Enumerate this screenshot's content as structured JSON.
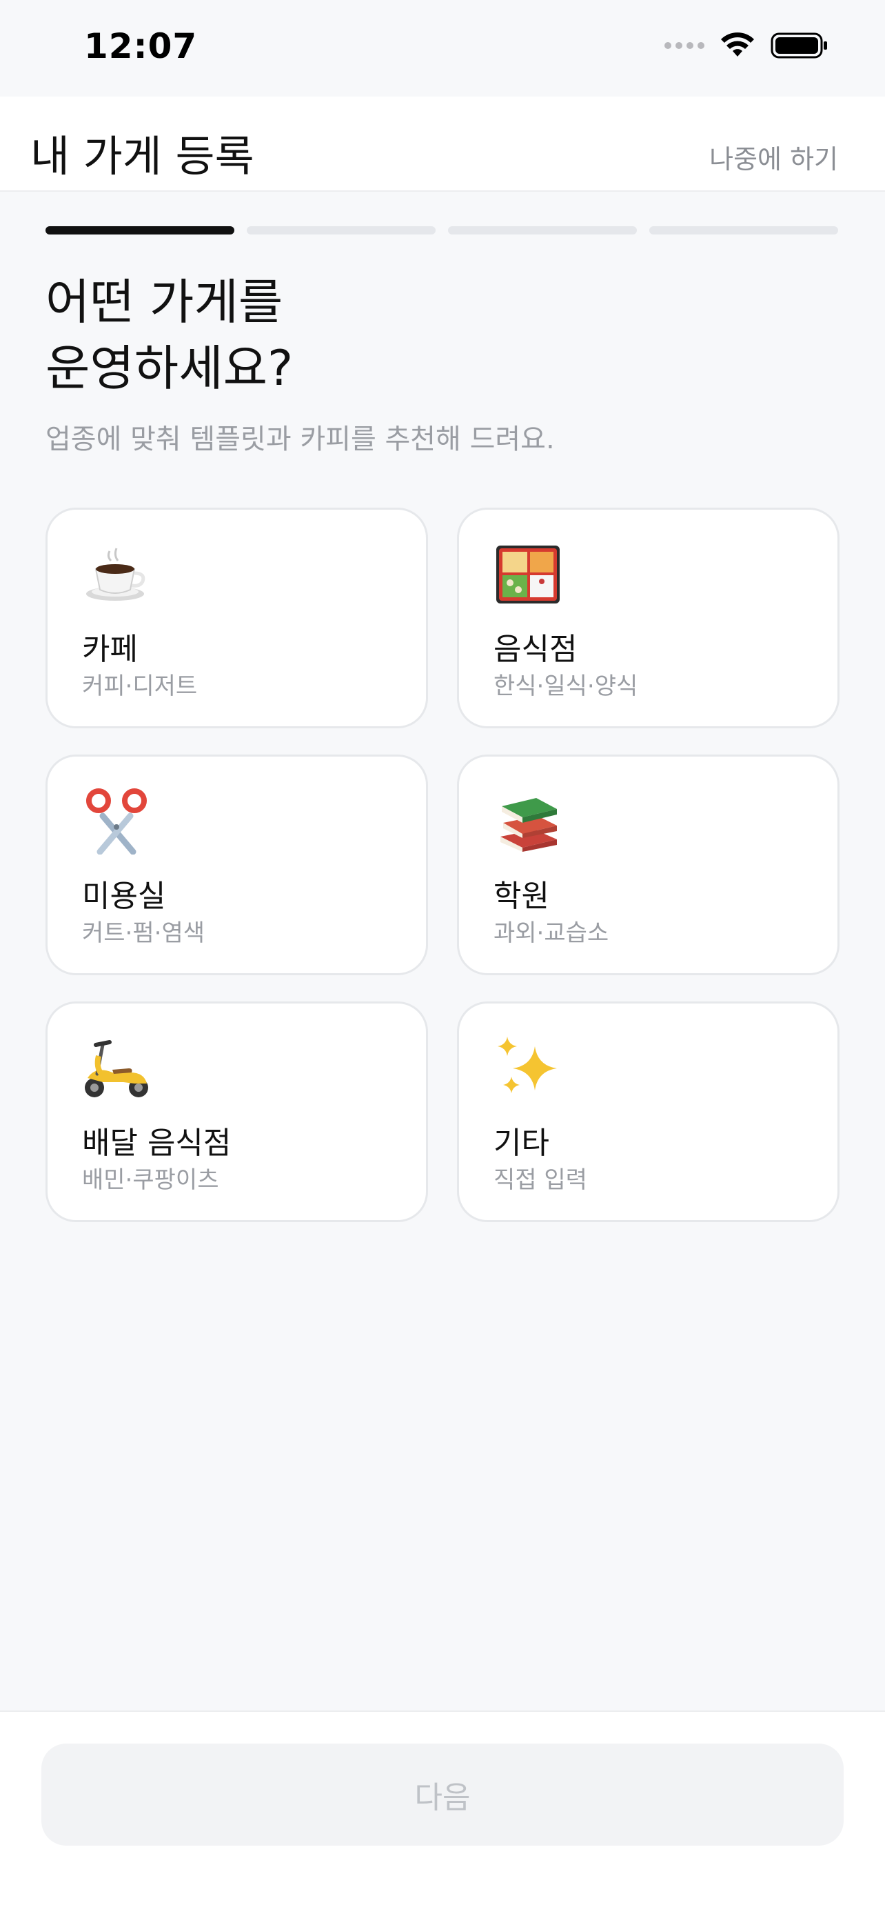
{
  "status_bar": {
    "time": "12:07"
  },
  "header": {
    "title": "내 가게 등록",
    "skip_label": "나중에 하기"
  },
  "progress": {
    "current_step": 1,
    "total_steps": 4
  },
  "main": {
    "question_line1": "어떤 가게를",
    "question_line2": "운영하세요?",
    "subtitle": "업종에 맞춰 템플릿과 카피를 추천해 드려요."
  },
  "categories": [
    {
      "icon": "coffee-cup-icon",
      "title": "카페",
      "subtitle": "커피·디저트"
    },
    {
      "icon": "bento-box-icon",
      "title": "음식점",
      "subtitle": "한식·일식·양식"
    },
    {
      "icon": "scissors-icon",
      "title": "미용실",
      "subtitle": "커트·펌·염색"
    },
    {
      "icon": "books-icon",
      "title": "학원",
      "subtitle": "과외·교습소"
    },
    {
      "icon": "scooter-icon",
      "title": "배달 음식점",
      "subtitle": "배민·쿠팡이츠"
    },
    {
      "icon": "sparkles-icon",
      "title": "기타",
      "subtitle": "직접 입력"
    }
  ],
  "footer": {
    "next_label": "다음"
  }
}
